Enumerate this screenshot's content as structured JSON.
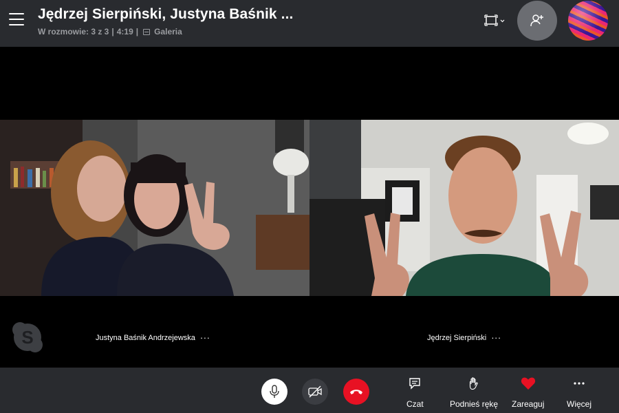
{
  "header": {
    "title": "Jędrzej Sierpiński, Justyna Baśnik ...",
    "participants_label": "W rozmowie: 3 z 3",
    "duration": "4:19",
    "view_label": "Galeria",
    "separator": "|"
  },
  "participants": [
    {
      "name": "Justyna Baśnik Andrzejewska",
      "more": "···"
    },
    {
      "name": "Jędrzej Sierpiński",
      "more": "···"
    }
  ],
  "logo": {
    "letter": "S"
  },
  "controls": {
    "chat_label": "Czat",
    "raise_hand_label": "Podnieś rękę",
    "react_label": "Zareaguj",
    "more_label": "Więcej"
  },
  "colors": {
    "header_bg": "#292b2f",
    "end_call": "#e81123",
    "heart": "#e81123"
  },
  "icons": [
    "menu-icon",
    "layout-icon",
    "add-person-icon",
    "mic-icon",
    "video-off-icon",
    "end-call-icon",
    "chat-icon",
    "raise-hand-icon",
    "heart-icon",
    "more-icon",
    "gallery-icon"
  ]
}
